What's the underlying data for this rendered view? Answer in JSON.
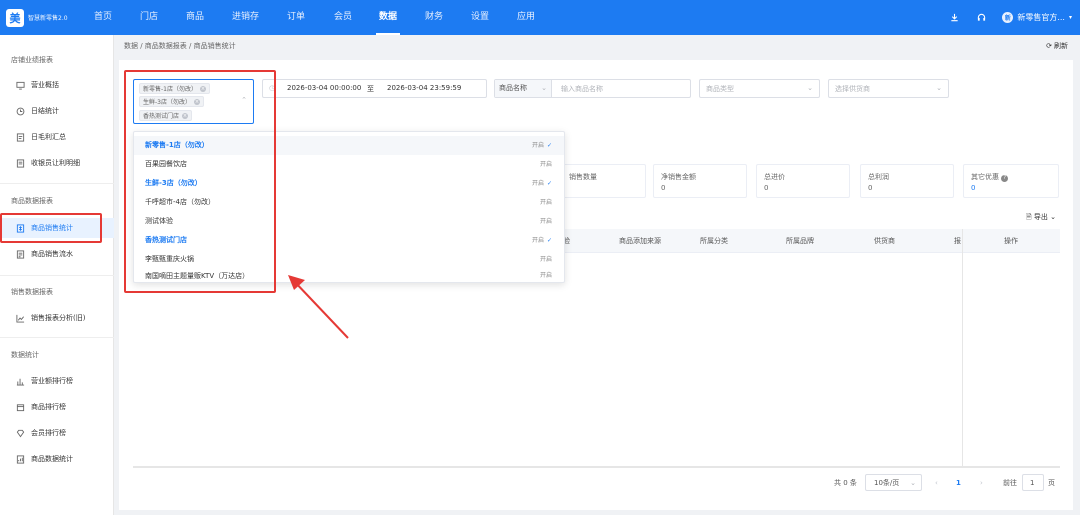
{
  "app": {
    "logo_text": "智慧新零售2.0",
    "logo_glyph": "美"
  },
  "nav": [
    "首页",
    "门店",
    "商品",
    "进销存",
    "订单",
    "会员",
    "数据",
    "财务",
    "设置",
    "应用"
  ],
  "top_right": {
    "avatar": "新",
    "shop_name": "新零售官方..."
  },
  "sidebar": {
    "group1": "店铺业绩报表",
    "group1_items": [
      "营业概括",
      "日结统计",
      "日毛利汇总",
      "收银员让利明细"
    ],
    "group2": "商品数据报表",
    "group2_items": [
      "商品销售统计",
      "商品销售流水"
    ],
    "group3": "销售数据报表",
    "group3_items": [
      "销售报表分析(旧)"
    ],
    "group4": "数据统计",
    "group4_items": [
      "营业额排行榜",
      "商品排行榜",
      "会员排行榜",
      "商品数据统计"
    ]
  },
  "breadcrumb": "数据 / 商品数据报表 / 商品销售统计",
  "refresh_label": "刷新",
  "filters": {
    "selected_stores": [
      "新零售-1店（勿改）",
      "生鲜-3店（勿改）",
      "香热测试门店"
    ],
    "date_start": "2026-03-04 00:00:00",
    "date_sep": "至",
    "date_end": "2026-03-04 23:59:59",
    "product_field_select": "商品名称",
    "product_name_placeholder": "输入商品名称",
    "product_type_placeholder": "商品类型",
    "supplier_placeholder": "选择供货商"
  },
  "cards": [
    {
      "label": "销售数量",
      "value": ""
    },
    {
      "label": "净销售金额",
      "value": "0"
    },
    {
      "label": "总进价",
      "value": "0"
    },
    {
      "label": "总利润",
      "value": "0"
    },
    {
      "label": "其它优惠",
      "value": "0"
    }
  ],
  "export_label": "导出",
  "table_headers": [
    "验",
    "商品添加来源",
    "所属分类",
    "所属品牌",
    "供货商",
    "报",
    "操作"
  ],
  "pagination": {
    "total": "共 0 条",
    "page_size": "10条/页",
    "current_page": "1",
    "goto_prefix": "前往",
    "goto_value": "1",
    "goto_suffix": "页"
  },
  "dropdown_items": [
    {
      "name": "新零售-1店（勿改）",
      "status": "开启",
      "selected": true
    },
    {
      "name": "百果园餐饮店",
      "status": "开启",
      "selected": false
    },
    {
      "name": "生鲜-3店（勿改）",
      "status": "开启",
      "selected": true
    },
    {
      "name": "千呼超市-4店（勿改）",
      "status": "开启",
      "selected": false
    },
    {
      "name": "测试体验",
      "status": "开启",
      "selected": false
    },
    {
      "name": "香热测试门店",
      "status": "开启",
      "selected": true
    },
    {
      "name": "李甄甄重庆火锅",
      "status": "开启",
      "selected": false
    },
    {
      "name": "南国嘀田主题量贩KTV（万达店）",
      "status": "开启",
      "selected": false
    }
  ],
  "colors": {
    "primary": "#1d7bf2",
    "annotation": "#e53935"
  }
}
